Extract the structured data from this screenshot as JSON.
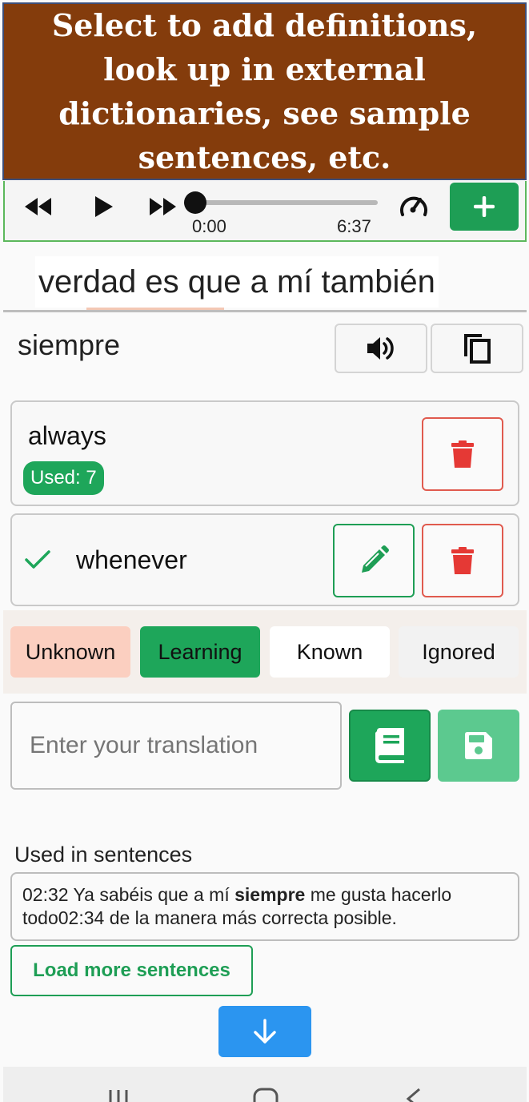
{
  "banner": {
    "text": "Select to add definitions, look up in external dictionaries, see sample sentences, etc."
  },
  "player": {
    "current_time": "0:00",
    "duration": "6:37",
    "progress": 0.0,
    "icons": [
      "rewind-icon",
      "play-icon",
      "fast-forward-icon",
      "speed-gauge-icon",
      "plus-icon"
    ]
  },
  "sentence": {
    "text": "verdad es que a mí también"
  },
  "term": {
    "word": "siempre"
  },
  "definitions": [
    {
      "text": "always",
      "used_label": "Used: 7"
    },
    {
      "text": "whenever",
      "checked": true
    }
  ],
  "status": {
    "unknown": "Unknown",
    "learning": "Learning",
    "known": "Known",
    "ignored": "Ignored",
    "selected": "Learning"
  },
  "translation": {
    "placeholder": "Enter your translation"
  },
  "sentences": {
    "title": "Used in sentences",
    "line1_before": "02:32 Ya sabéis que a mí ",
    "line1_bold": "siempre",
    "line1_after": " me gusta hacerlo",
    "line2": "todo02:34 de la manera más correcta posible.",
    "load_more": "Load more sentences"
  },
  "colors": {
    "banner": "#843c0c",
    "green": "#1ea65a",
    "red": "#e53935",
    "blue": "#2b95f0",
    "unknown_bg": "#fbcfc0",
    "status_bg": "#f4efeb"
  }
}
